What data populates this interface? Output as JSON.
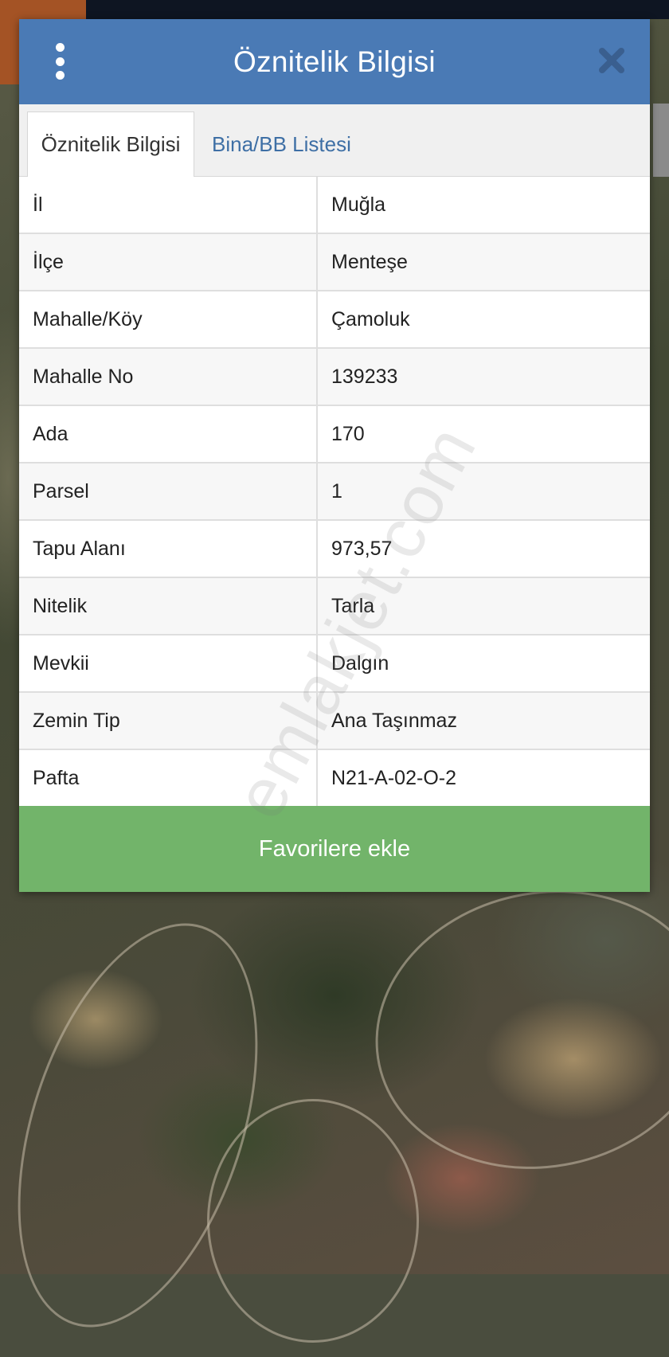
{
  "dialog": {
    "title": "Öznitelik Bilgisi",
    "tabs": [
      {
        "label": "Öznitelik Bilgisi",
        "active": true
      },
      {
        "label": "Bina/BB Listesi",
        "active": false
      }
    ],
    "rows": [
      {
        "key": "İl",
        "value": "Muğla"
      },
      {
        "key": "İlçe",
        "value": "Menteşe"
      },
      {
        "key": "Mahalle/Köy",
        "value": "Çamoluk"
      },
      {
        "key": "Mahalle No",
        "value": "139233"
      },
      {
        "key": "Ada",
        "value": "170"
      },
      {
        "key": "Parsel",
        "value": "1"
      },
      {
        "key": "Tapu Alanı",
        "value": "973,57"
      },
      {
        "key": "Nitelik",
        "value": "Tarla"
      },
      {
        "key": "Mevkii",
        "value": "Dalgın"
      },
      {
        "key": "Zemin Tip",
        "value": "Ana Taşınmaz"
      },
      {
        "key": "Pafta",
        "value": "N21-A-02-O-2"
      }
    ],
    "favorite_button": "Favorilere ekle",
    "icons": {
      "menu": "more-vertical-icon",
      "close": "close-icon"
    }
  },
  "watermark": "emlakjet.com",
  "colors": {
    "header": "#4a7ab5",
    "tab_link": "#3e6fa5",
    "favorite": "#72b46a"
  }
}
